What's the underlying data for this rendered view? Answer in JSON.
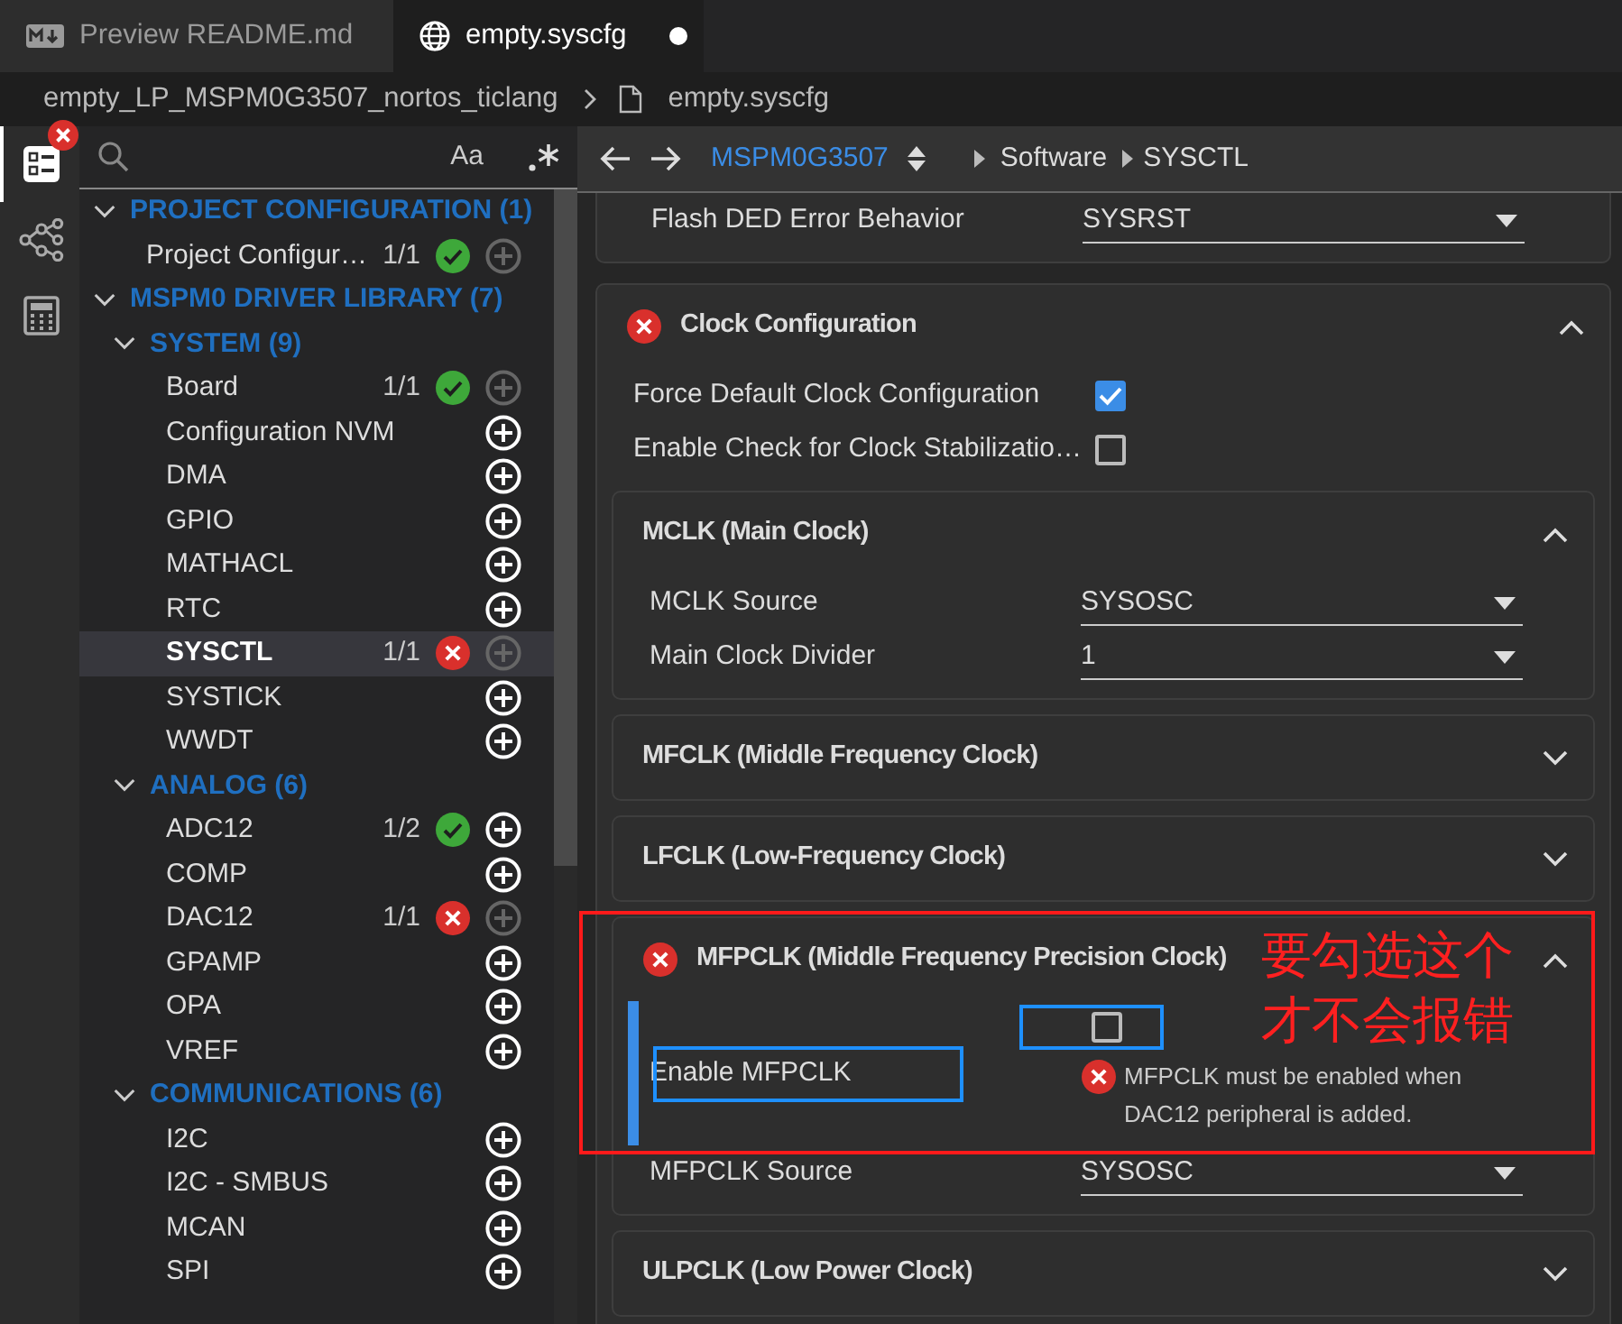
{
  "tabs": [
    {
      "label": "Preview README.md",
      "kind": "markdown",
      "selected": false,
      "modified": false
    },
    {
      "label": "empty.syscfg",
      "kind": "syscfg",
      "selected": true,
      "modified": true
    }
  ],
  "breadcrumb": {
    "folder": "empty_LP_MSPM0G3507_nortos_ticlang",
    "file": "empty.syscfg"
  },
  "activity_bar": [
    {
      "kind": "config",
      "selected": true,
      "error": true
    },
    {
      "kind": "topology",
      "selected": false,
      "error": false
    },
    {
      "kind": "calculator",
      "selected": false,
      "error": false
    }
  ],
  "search": {
    "case_toggle": "Aa"
  },
  "tree": [
    {
      "kind": "group",
      "label": "PROJECT CONFIGURATION (1)",
      "expanded": true,
      "children": [
        {
          "kind": "module",
          "label": "Project Configur…",
          "count": "1/1",
          "error": false,
          "can_add": false,
          "selected": false
        }
      ]
    },
    {
      "kind": "group",
      "label": "MSPM0 DRIVER LIBRARY (7)",
      "expanded": true,
      "children": [
        {
          "kind": "group",
          "label": "SYSTEM (9)",
          "expanded": true,
          "children": [
            {
              "kind": "module",
              "label": "Board",
              "count": "1/1",
              "error": false,
              "can_add": false,
              "selected": false
            },
            {
              "kind": "module",
              "label": "Configuration NVM",
              "can_add": true,
              "selected": false
            },
            {
              "kind": "module",
              "label": "DMA",
              "can_add": true,
              "selected": false
            },
            {
              "kind": "module",
              "label": "GPIO",
              "can_add": true,
              "selected": false
            },
            {
              "kind": "module",
              "label": "MATHACL",
              "can_add": true,
              "selected": false
            },
            {
              "kind": "module",
              "label": "RTC",
              "can_add": true,
              "selected": false
            },
            {
              "kind": "module",
              "label": "SYSCTL",
              "count": "1/1",
              "error": true,
              "can_add": false,
              "selected": true
            },
            {
              "kind": "module",
              "label": "SYSTICK",
              "can_add": true,
              "selected": false
            },
            {
              "kind": "module",
              "label": "WWDT",
              "can_add": true,
              "selected": false
            }
          ]
        },
        {
          "kind": "group",
          "label": "ANALOG (6)",
          "expanded": true,
          "children": [
            {
              "kind": "module",
              "label": "ADC12",
              "count": "1/2",
              "error": false,
              "can_add": true,
              "selected": false
            },
            {
              "kind": "module",
              "label": "COMP",
              "can_add": true,
              "selected": false
            },
            {
              "kind": "module",
              "label": "DAC12",
              "count": "1/1",
              "error": true,
              "can_add": false,
              "selected": false
            },
            {
              "kind": "module",
              "label": "GPAMP",
              "can_add": true,
              "selected": false
            },
            {
              "kind": "module",
              "label": "OPA",
              "can_add": true,
              "selected": false
            },
            {
              "kind": "module",
              "label": "VREF",
              "can_add": true,
              "selected": false
            }
          ]
        },
        {
          "kind": "group",
          "label": "COMMUNICATIONS (6)",
          "expanded": true,
          "children": [
            {
              "kind": "module",
              "label": "I2C",
              "can_add": true,
              "selected": false
            },
            {
              "kind": "module",
              "label": "I2C - SMBUS",
              "can_add": true,
              "selected": false
            },
            {
              "kind": "module",
              "label": "MCAN",
              "can_add": true,
              "selected": false
            },
            {
              "kind": "module",
              "label": "SPI",
              "can_add": true,
              "selected": false
            }
          ]
        }
      ]
    }
  ],
  "nav": {
    "device": "MSPM0G3507",
    "path": [
      "Software",
      "SYSCTL"
    ]
  },
  "sections": [
    {
      "kind": "partial",
      "rows": [
        {
          "kind": "select",
          "label": "Flash DED Error Behavior",
          "value": "SYSRST"
        }
      ]
    },
    {
      "kind": "card",
      "title": "Clock Configuration",
      "error": true,
      "expanded": true,
      "rows": [
        {
          "kind": "checkbox",
          "label": "Force Default Clock Configuration",
          "checked": true
        },
        {
          "kind": "checkbox",
          "label": "Enable Check for Clock Stabilizatio…",
          "checked": false
        }
      ],
      "subsections": [
        {
          "title": "MCLK (Main Clock)",
          "error": false,
          "expanded": true,
          "rows": [
            {
              "kind": "select",
              "label": "MCLK Source",
              "value": "SYSOSC"
            },
            {
              "kind": "select",
              "label": "Main Clock Divider",
              "value": "1"
            }
          ]
        },
        {
          "title": "MFCLK (Middle Frequency Clock)",
          "error": false,
          "expanded": false
        },
        {
          "title": "LFCLK (Low-Frequency Clock)",
          "error": false,
          "expanded": false
        },
        {
          "title": "MFPCLK (Middle Frequency Precision Clock)",
          "error": true,
          "expanded": true,
          "annotated": true,
          "rows": [
            {
              "kind": "checkbox",
              "label": "Enable MFPCLK",
              "checked": false,
              "focused": true,
              "error_message": "MFPCLK must be enabled when DAC12 peripheral is added."
            },
            {
              "kind": "select",
              "label": "MFPCLK Source",
              "value": "SYSOSC"
            }
          ]
        },
        {
          "title": "ULPCLK (Low Power Clock)",
          "error": false,
          "expanded": false
        }
      ]
    }
  ],
  "annotation": {
    "lines": [
      "要勾选这个",
      "才不会报错"
    ]
  }
}
